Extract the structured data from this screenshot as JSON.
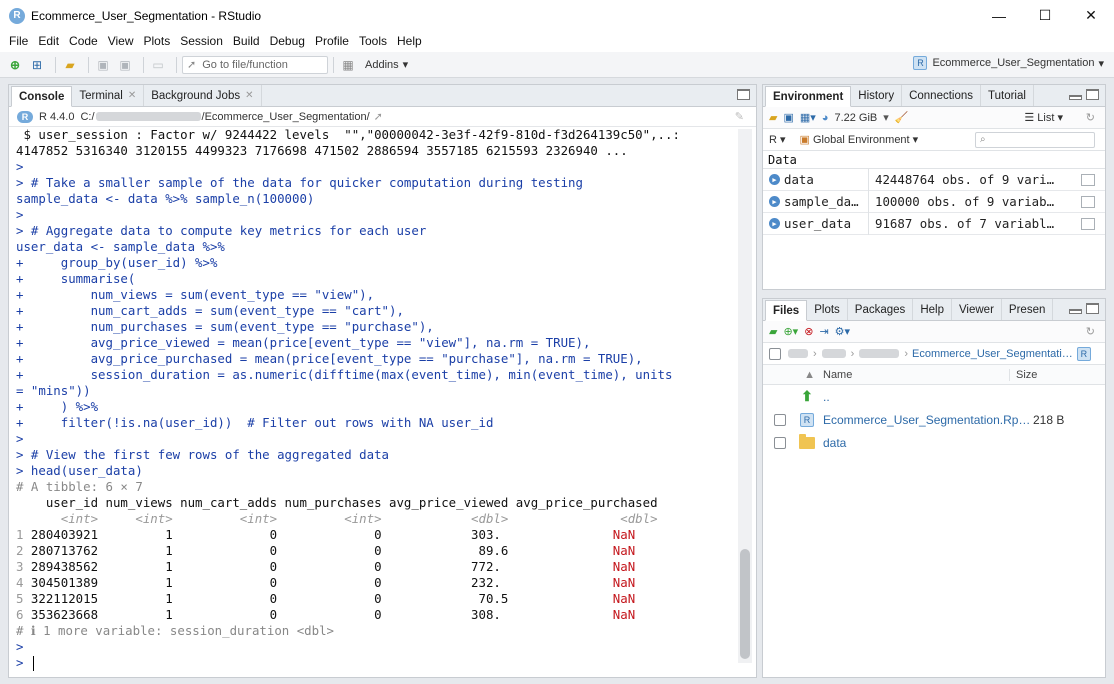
{
  "window": {
    "title": "Ecommerce_User_Segmentation - RStudio",
    "logo": "R"
  },
  "menu": [
    "File",
    "Edit",
    "Code",
    "View",
    "Plots",
    "Session",
    "Build",
    "Debug",
    "Profile",
    "Tools",
    "Help"
  ],
  "toolbar": {
    "goto_placeholder": "Go to file/function",
    "addins_label": "Addins",
    "project_label": "Ecommerce_User_Segmentation"
  },
  "left_pane": {
    "tabs": [
      {
        "label": "Console",
        "active": true
      },
      {
        "label": "Terminal",
        "active": false
      },
      {
        "label": "Background Jobs",
        "active": false
      }
    ],
    "r_version": "R 4.4.0",
    "path_prefix": "C:/",
    "path_suffix": "/Ecommerce_User_Segmentation/",
    "console_lines": [
      {
        "cls": "out",
        "text": " $ user_session : Factor w/ 9244422 levels  \"\",\"00000042-3e3f-42f9-810d-f3d264139c50\",..: "
      },
      {
        "cls": "out",
        "text": "4147852 5316340 3120155 4499323 7176698 471502 2886594 3557185 6215593 2326940 ..."
      },
      {
        "cls": "cmd",
        "text": ">"
      },
      {
        "cls": "cmd",
        "text": "> # Take a smaller sample of the data for quicker computation during testing"
      },
      {
        "cls": "cmd",
        "text": "sample_data <- data %>% sample_n(100000)"
      },
      {
        "cls": "cmd",
        "text": ">"
      },
      {
        "cls": "cmd",
        "text": "> # Aggregate data to compute key metrics for each user"
      },
      {
        "cls": "cmd",
        "text": "user_data <- sample_data %>%"
      },
      {
        "cls": "cmd",
        "text": "+     group_by(user_id) %>%"
      },
      {
        "cls": "cmd",
        "text": "+     summarise("
      },
      {
        "cls": "cmd",
        "text": "+         num_views = sum(event_type == \"view\"),"
      },
      {
        "cls": "cmd",
        "text": "+         num_cart_adds = sum(event_type == \"cart\"),"
      },
      {
        "cls": "cmd",
        "text": "+         num_purchases = sum(event_type == \"purchase\"),"
      },
      {
        "cls": "cmd",
        "text": "+         avg_price_viewed = mean(price[event_type == \"view\"], na.rm = TRUE),"
      },
      {
        "cls": "cmd",
        "text": "+         avg_price_purchased = mean(price[event_type == \"purchase\"], na.rm = TRUE),"
      },
      {
        "cls": "cmd",
        "text": "+         session_duration = as.numeric(difftime(max(event_time), min(event_time), units"
      },
      {
        "cls": "cmd",
        "text": "= \"mins\"))"
      },
      {
        "cls": "cmd",
        "text": "+     ) %>%"
      },
      {
        "cls": "cmd",
        "text": "+     filter(!is.na(user_id))  # Filter out rows with NA user_id"
      },
      {
        "cls": "cmd",
        "text": ">"
      },
      {
        "cls": "cmd",
        "text": "> # View the first few rows of the aggregated data"
      },
      {
        "cls": "cmd",
        "text": "> head(user_data)"
      },
      {
        "cls": "cmt",
        "text": "# A tibble: 6 × 7"
      },
      {
        "cls": "out",
        "text": "    user_id num_views num_cart_adds num_purchases avg_price_viewed avg_price_purchased"
      },
      {
        "cls": "type",
        "text": "      <int>     <int>         <int>         <int>            <dbl>               <dbl>"
      },
      {
        "cls": "row",
        "rn": "1",
        "text": " 280403921         1             0             0            303.  ",
        "nan": "             NaN"
      },
      {
        "cls": "row",
        "rn": "2",
        "text": " 280713762         1             0             0             89.6 ",
        "nan": "             NaN"
      },
      {
        "cls": "row",
        "rn": "3",
        "text": " 289438562         1             0             0            772.  ",
        "nan": "             NaN"
      },
      {
        "cls": "row",
        "rn": "4",
        "text": " 304501389         1             0             0            232.  ",
        "nan": "             NaN"
      },
      {
        "cls": "row",
        "rn": "5",
        "text": " 322112015         1             0             0             70.5 ",
        "nan": "             NaN"
      },
      {
        "cls": "row",
        "rn": "6",
        "text": " 353623668         1             0             0            308.  ",
        "nan": "             NaN"
      },
      {
        "cls": "cmt",
        "text": "# ℹ 1 more variable: session_duration <dbl>"
      },
      {
        "cls": "cmd",
        "text": ">"
      },
      {
        "cls": "prompt",
        "text": "> "
      }
    ]
  },
  "env_pane": {
    "tabs": [
      {
        "label": "Environment",
        "active": true
      },
      {
        "label": "History",
        "active": false
      },
      {
        "label": "Connections",
        "active": false
      },
      {
        "label": "Tutorial",
        "active": false
      }
    ],
    "memory": "7.22 GiB",
    "view_mode": "List",
    "language": "R",
    "scope": "Global Environment",
    "section": "Data",
    "rows": [
      {
        "name": "data",
        "value": "42448764 obs. of 9 vari…"
      },
      {
        "name": "sample_da…",
        "value": "100000 obs. of 9 variab…"
      },
      {
        "name": "user_data",
        "value": "91687 obs. of 7 variabl…"
      }
    ]
  },
  "files_pane": {
    "tabs": [
      {
        "label": "Files",
        "active": true
      },
      {
        "label": "Plots",
        "active": false
      },
      {
        "label": "Packages",
        "active": false
      },
      {
        "label": "Help",
        "active": false
      },
      {
        "label": "Viewer",
        "active": false
      },
      {
        "label": "Presen",
        "active": false
      }
    ],
    "breadcrumb_current": "Ecommerce_User_Segmentati…",
    "col_name": "Name",
    "col_size": "Size",
    "parent_label": "..",
    "files": [
      {
        "name": "Ecommerce_User_Segmentation.Rp…",
        "size": "218 B",
        "type": "rproj"
      },
      {
        "name": "data",
        "size": "",
        "type": "folder"
      }
    ]
  }
}
